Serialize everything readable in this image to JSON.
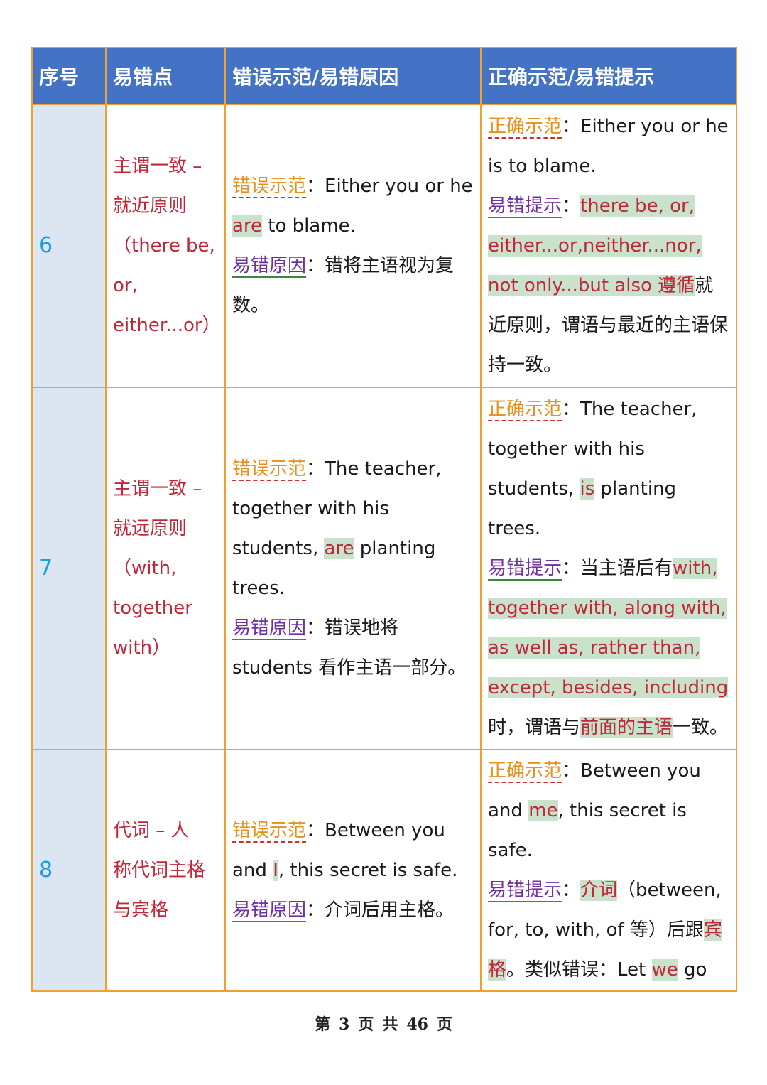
{
  "header": {
    "col1": "序号",
    "col2": "易错点",
    "col3": "错误示范/易错原因",
    "col4": "正确示范/易错提示"
  },
  "labels": {
    "wrong_demo": "错误示范",
    "wrong_reason": "易错原因",
    "right_demo": "正确示范",
    "tip": "易错提示",
    "colon": "："
  },
  "rows": [
    {
      "num": "6",
      "topic": [
        "主谓一致 –",
        "就近原则",
        "（there be,",
        "or,",
        "either...or）"
      ],
      "wrong": {
        "pre": "Either you or he ",
        "hl": "are",
        "post": " to blame.",
        "reason": "错将主语视为复数。"
      },
      "right": {
        "text": "Either you or he is to blame.",
        "tip_hl": "there be, or, either...or,neither...nor, not only...but also 遵循",
        "tip_post": "就近原则，谓语与最近的主语保持一致。"
      }
    },
    {
      "num": "7",
      "topic": [
        "主谓一致 –",
        "就远原则",
        "（with,",
        "together",
        "with）"
      ],
      "wrong": {
        "pre": "The teacher, together with his students, ",
        "hl": "are",
        "post": " planting trees.",
        "reason": "错误地将students 看作主语一部分。"
      },
      "right": {
        "pre": "The teacher, together with his students, ",
        "hl": "is",
        "post": " planting trees.",
        "tip_pre": "当主语后有",
        "tip_hl": "with, together with, along with, as well as, rather than, except, besides, including",
        "tip_mid": "时，谓语与",
        "tip_hl2": "前面的主语",
        "tip_post": "一致。"
      }
    },
    {
      "num": "8",
      "topic": [
        "代词 – 人",
        "称代词主格",
        "与宾格"
      ],
      "wrong": {
        "pre": "Between you and ",
        "hl": "I",
        "post": ", this secret is safe.",
        "reason": "介词后用主格。"
      },
      "right": {
        "pre": "Between you and ",
        "hl": "me",
        "post": ", this secret is safe.",
        "tip_hl": "介词",
        "tip_mid": "（between, for, to, with, of 等）后跟",
        "tip_hl2": "宾格",
        "tip_mid2": "。类似错误：Let ",
        "tip_hl3": "we",
        "tip_post": " go"
      }
    }
  ],
  "footer": {
    "prefix": "第",
    "page": "3",
    "mid1": "页",
    "mid2": "共",
    "total": "46",
    "suffix": "页"
  }
}
